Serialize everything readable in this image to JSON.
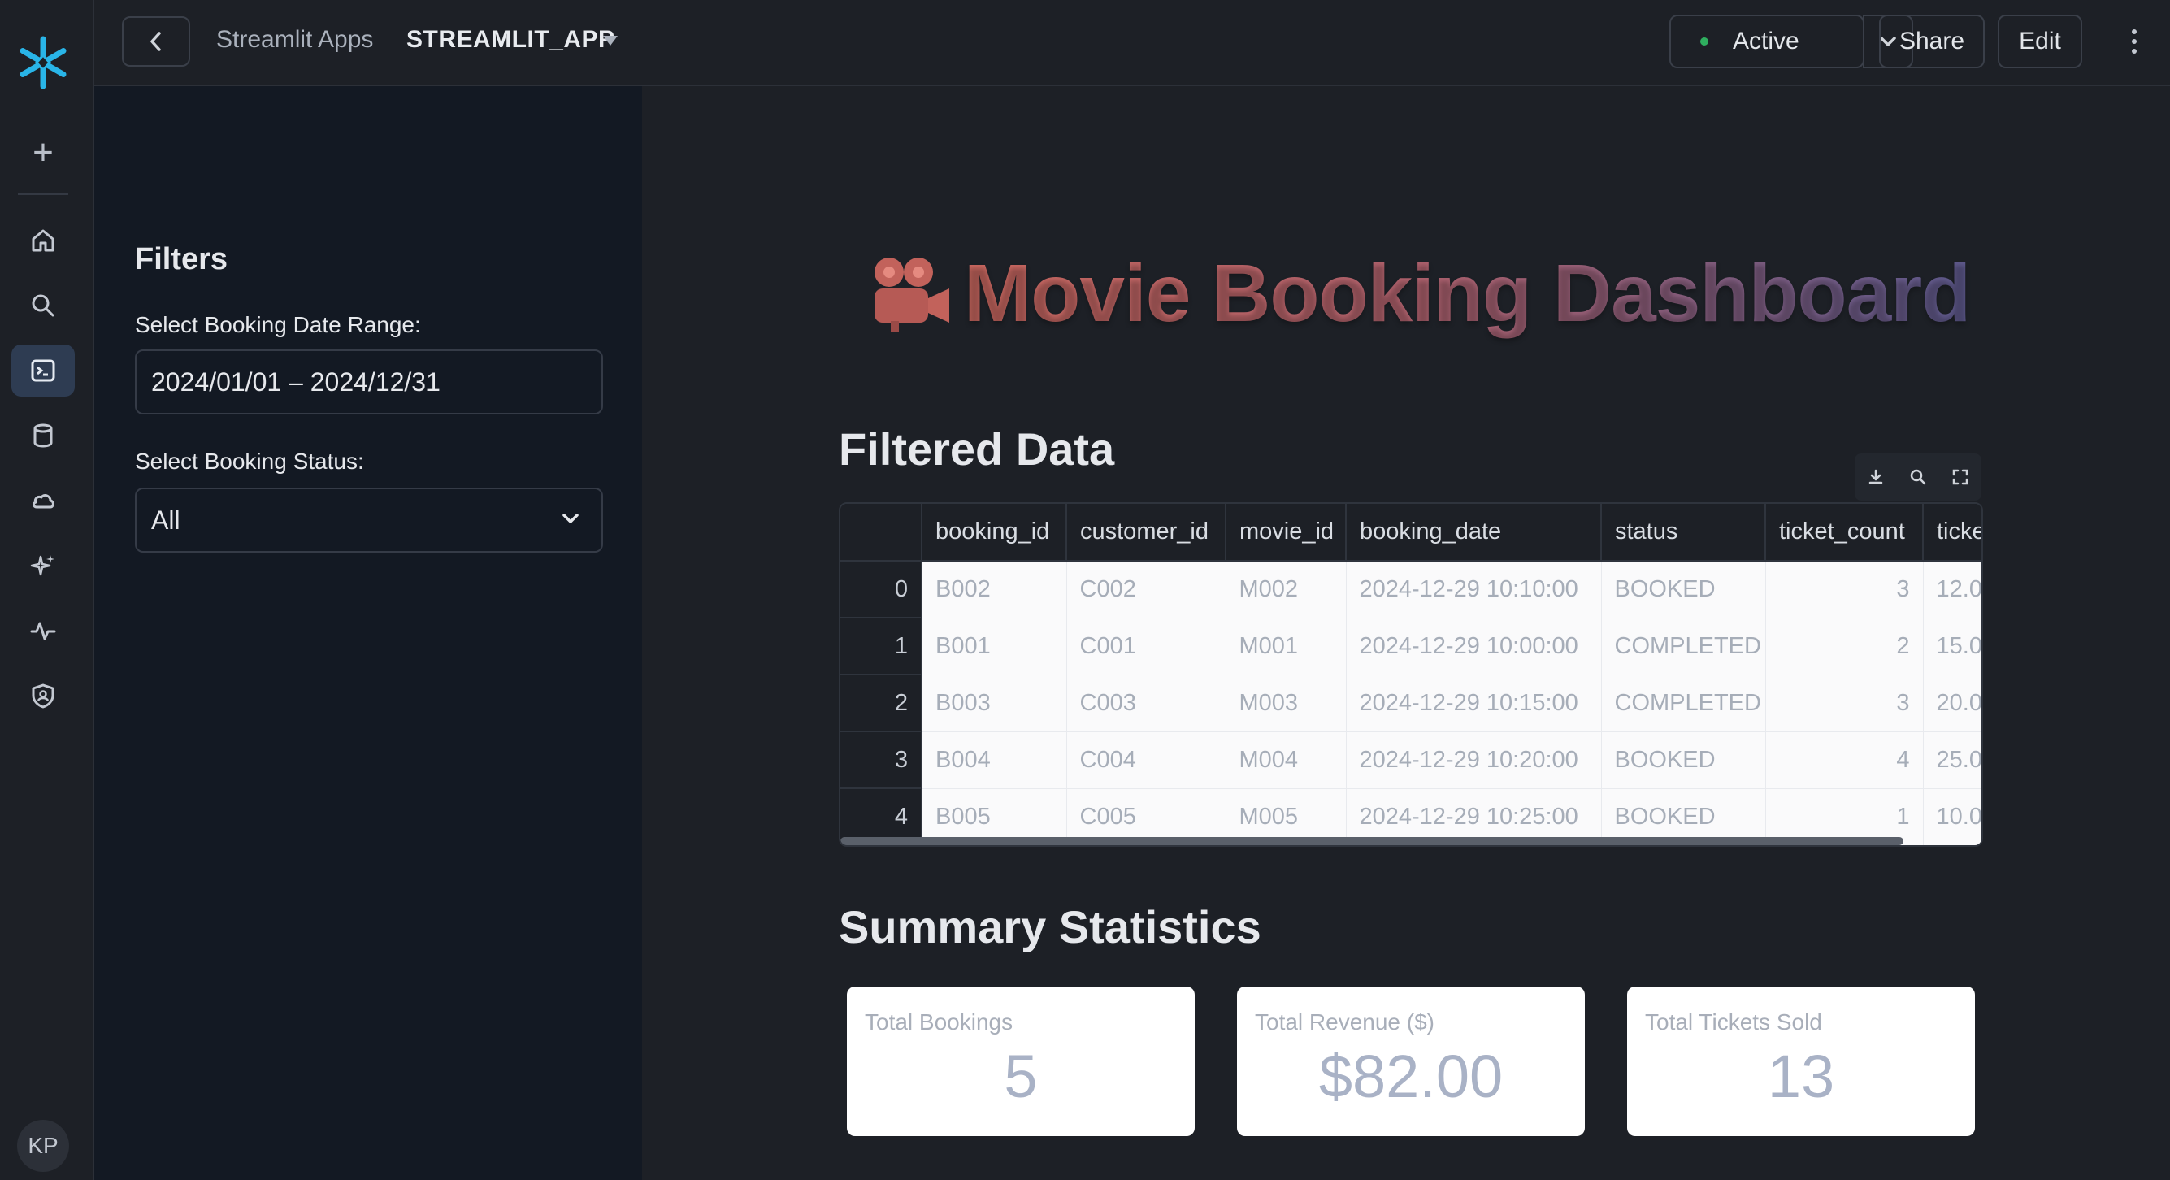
{
  "topbar": {
    "breadcrumb": "Streamlit Apps",
    "app_name": "STREAMLIT_APP",
    "status_label": "Active",
    "share_label": "Share",
    "edit_label": "Edit"
  },
  "rail": {
    "items": [
      "home-icon",
      "search-icon",
      "projects-icon",
      "data-icon",
      "cloud-icon",
      "ai-icon",
      "monitoring-icon",
      "admin-icon"
    ],
    "active_item": "projects-icon",
    "avatar_initials": "KP"
  },
  "sidebar": {
    "title": "Filters",
    "date_label": "Select Booking Date Range:",
    "date_value": "2024/01/01 – 2024/12/31",
    "status_label": "Select Booking Status:",
    "status_value": "All"
  },
  "main": {
    "title": "Movie Booking Dashboard",
    "title_icon": "movie-camera-emoji",
    "filtered_heading": "Filtered Data",
    "summary_heading": "Summary Statistics"
  },
  "table": {
    "columns": [
      "",
      "booking_id",
      "customer_id",
      "movie_id",
      "booking_date",
      "status",
      "ticket_count",
      "ticke"
    ],
    "rows": [
      [
        "0",
        "B002",
        "C002",
        "M002",
        "2024-12-29 10:10:00",
        "BOOKED",
        "3",
        "12.0"
      ],
      [
        "1",
        "B001",
        "C001",
        "M001",
        "2024-12-29 10:00:00",
        "COMPLETED",
        "2",
        "15.0"
      ],
      [
        "2",
        "B003",
        "C003",
        "M003",
        "2024-12-29 10:15:00",
        "COMPLETED",
        "3",
        "20.0"
      ],
      [
        "3",
        "B004",
        "C004",
        "M004",
        "2024-12-29 10:20:00",
        "BOOKED",
        "4",
        "25.0"
      ],
      [
        "4",
        "B005",
        "C005",
        "M005",
        "2024-12-29 10:25:00",
        "BOOKED",
        "1",
        "10.0"
      ]
    ]
  },
  "metrics": [
    {
      "label": "Total Bookings",
      "value": "5"
    },
    {
      "label": "Total Revenue ($)",
      "value": "$82.00"
    },
    {
      "label": "Total Tickets Sold",
      "value": "13"
    }
  ],
  "colors": {
    "background": "#1d2026",
    "sidebar": "#131923",
    "status_dot": "#2fae5f",
    "title_gradient_start": "#c9675f",
    "title_gradient_end": "#5e5a8e"
  }
}
